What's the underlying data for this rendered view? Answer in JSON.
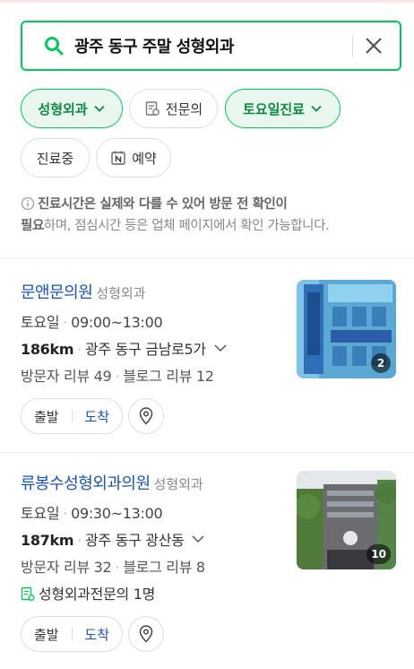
{
  "search": {
    "query": "광주 동구 주말 성형외과"
  },
  "filters": [
    {
      "label": "성형외과",
      "active": true,
      "dropdown": true
    },
    {
      "label": "전문의",
      "active": false,
      "icon": "specialist-doc-icon"
    },
    {
      "label": "토요일진료",
      "active": true,
      "dropdown": true
    },
    {
      "label": "진료중",
      "active": false
    },
    {
      "label": "예약",
      "active": false,
      "icon": "naver-n-icon"
    }
  ],
  "notice": {
    "bold1": "진료시간은 실제와 다를 수 있어 방문 전 확인이",
    "bold2": "필요",
    "rest": "하며, 점심시간 등은 업체 페이지에서 확인 가능합니다."
  },
  "results": [
    {
      "name": "문앤문의원",
      "category": "성형외과",
      "day": "토요일",
      "hours": "09:00~13:00",
      "distance": "186km",
      "address": "광주 동구 금남로5가",
      "visitor_reviews": "방문자 리뷰 49",
      "blog_reviews": "블로그 리뷰 12",
      "photo_count": "2",
      "start_label": "출발",
      "arrive_label": "도착"
    },
    {
      "name": "류봉수성형외과의원",
      "category": "성형외과",
      "day": "토요일",
      "hours": "09:30~13:00",
      "distance": "187km",
      "address": "광주 동구 광산동",
      "visitor_reviews": "방문자 리뷰 32",
      "blog_reviews": "블로그 리뷰 8",
      "specialist": "성형외과전문의 1명",
      "photo_count": "10",
      "start_label": "출발",
      "arrive_label": "도착"
    }
  ],
  "colors": {
    "accent": "#03c75a",
    "link": "#1a53b5"
  }
}
